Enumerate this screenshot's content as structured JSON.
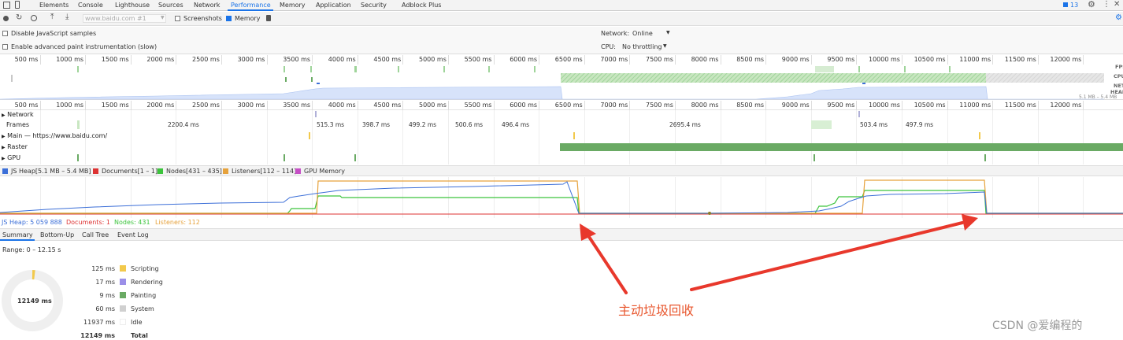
{
  "tabs": [
    "Elements",
    "Console",
    "Lighthouse",
    "Sources",
    "Network",
    "Performance",
    "Memory",
    "Application",
    "Security",
    "Adblock Plus"
  ],
  "active_tab": "Performance",
  "badge_count": "13",
  "toolbar": {
    "url_placeholder": "www.baidu.com #1",
    "screenshots_label": "Screenshots",
    "memory_label": "Memory"
  },
  "options": {
    "disable_js_samples": "Disable JavaScript samples",
    "advanced_paint": "Enable advanced paint instrumentation (slow)",
    "network_label": "Network:",
    "network_value": "Online",
    "cpu_label": "CPU:",
    "cpu_value": "No throttling"
  },
  "ruler_ticks": [
    "500 ms",
    "1000 ms",
    "1500 ms",
    "2000 ms",
    "2500 ms",
    "3000 ms",
    "3500 ms",
    "4000 ms",
    "4500 ms",
    "5000 ms",
    "5500 ms",
    "6000 ms",
    "6500 ms",
    "7000 ms",
    "7500 ms",
    "8000 ms",
    "8500 ms",
    "9000 ms",
    "9500 ms",
    "10000 ms",
    "10500 ms",
    "11000 ms",
    "11500 ms",
    "12000 ms"
  ],
  "overview_labels": {
    "fps": "FPS",
    "cpu": "CPU",
    "net": "NET",
    "heap": "HEAP",
    "heap_range": "5.1 MB – 5.4 MB"
  },
  "tracks": {
    "network": "Network",
    "frames": "Frames",
    "main": "Main — https://www.baidu.com/",
    "raster": "Raster",
    "gpu": "GPU"
  },
  "frame_times": [
    "2200.4 ms",
    "515.3 ms",
    "398.7 ms",
    "499.2 ms",
    "500.6 ms",
    "496.4 ms",
    "2695.4 ms",
    "503.4 ms",
    "497.9 ms"
  ],
  "legend": {
    "js_heap": "JS Heap[5.1 MB – 5.4 MB]",
    "documents": "Documents[1 – 1]",
    "nodes": "Nodes[431 – 435]",
    "listeners": "Listeners[112 – 114]",
    "gpu_memory": "GPU Memory"
  },
  "counters": {
    "js_heap": "JS Heap: 5 059 888",
    "documents": "Documents: 1",
    "nodes": "Nodes: 431",
    "listeners": "Listeners: 112"
  },
  "subtabs": [
    "Summary",
    "Bottom-Up",
    "Call Tree",
    "Event Log"
  ],
  "summary": {
    "range": "Range: 0 – 12.15 s",
    "donut_total": "12149 ms",
    "rows": [
      {
        "value": "125 ms",
        "name": "Scripting",
        "color": "#f2c94c"
      },
      {
        "value": "17 ms",
        "name": "Rendering",
        "color": "#9b8fe8"
      },
      {
        "value": "9 ms",
        "name": "Painting",
        "color": "#6aaa64"
      },
      {
        "value": "60 ms",
        "name": "System",
        "color": "#d0d0d0"
      },
      {
        "value": "11937 ms",
        "name": "Idle",
        "color": "#ffffff"
      },
      {
        "value": "12149 ms",
        "name": "Total",
        "color": ""
      }
    ]
  },
  "annotation": "主动垃圾回收",
  "watermark": "CSDN @爱编程的",
  "colors": {
    "accent": "#1a73e8",
    "heap": "#3c6fd8",
    "documents": "#d33",
    "nodes": "#3cc43c",
    "listeners": "#e6a23c",
    "arrow": "#e8382c"
  }
}
